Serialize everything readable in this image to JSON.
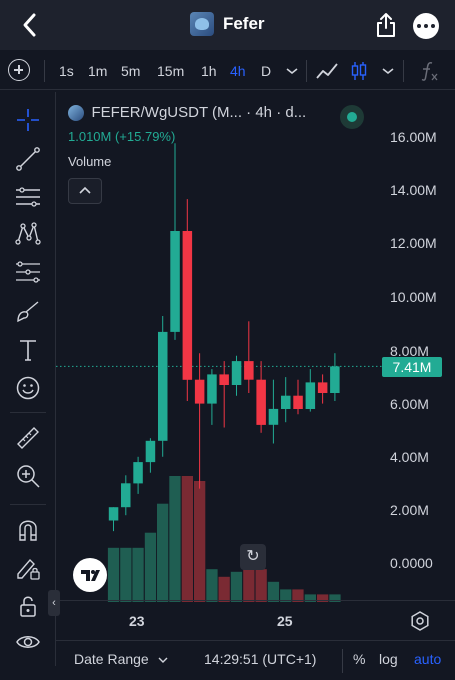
{
  "header": {
    "title": "Fefer",
    "back_icon": "chevron-left-icon",
    "share_icon": "share-icon",
    "more_icon": "more-horizontal-icon"
  },
  "toolbar": {
    "timeframes": [
      "1s",
      "1m",
      "5m",
      "15m",
      "1h",
      "4h",
      "D"
    ],
    "active_timeframe": "4h",
    "icons": [
      "add-indicator-icon",
      "chevron-down-icon",
      "line-tool-icon",
      "candles-icon",
      "chevron-down-icon",
      "formula-icon"
    ]
  },
  "left_tools": [
    "crosshair-icon",
    "trend-line-icon",
    "fib-icon",
    "pattern-icon",
    "projection-icon",
    "brush-icon",
    "text-icon",
    "emoji-icon",
    "ruler-icon",
    "zoom-in-icon",
    "magnet-icon",
    "pencil-lock-icon",
    "lock-icon",
    "eye-icon"
  ],
  "legend": {
    "symbol": "FEFER/WgUSDT (M... · 4h · d...",
    "change": "1.010M (+15.79%)",
    "volume_label": "Volume"
  },
  "price_axis": {
    "ticks": [
      "16.00M",
      "14.00M",
      "12.00M",
      "10.00M",
      "8.00M",
      "6.00M",
      "4.00M",
      "2.00M",
      "0.0000"
    ],
    "current_price": "7.41M"
  },
  "time_axis": {
    "ticks": [
      "23",
      "25"
    ]
  },
  "bottom_bar": {
    "date_range": "Date Range",
    "time": "14:29:51 (UTC+1)",
    "percent": "%",
    "log": "log",
    "auto": "auto"
  },
  "colors": {
    "up": "#22ab94",
    "down": "#f23645",
    "accent": "#2962ff",
    "background": "#131722"
  },
  "chart_data": {
    "type": "candlestick",
    "y_unit": "M",
    "ylim": [
      0,
      16
    ],
    "candles": [
      {
        "o": 1.6,
        "h": 2.1,
        "l": 1.2,
        "c": 2.1
      },
      {
        "o": 2.1,
        "h": 3.3,
        "l": 1.8,
        "c": 3.0
      },
      {
        "o": 3.0,
        "h": 4.0,
        "l": 2.6,
        "c": 3.8
      },
      {
        "o": 3.8,
        "h": 4.7,
        "l": 3.4,
        "c": 4.6
      },
      {
        "o": 4.6,
        "h": 9.3,
        "l": 4.0,
        "c": 8.7
      },
      {
        "o": 8.7,
        "h": 15.8,
        "l": 8.4,
        "c": 12.5
      },
      {
        "o": 12.5,
        "h": 13.7,
        "l": 6.1,
        "c": 6.9
      },
      {
        "o": 6.9,
        "h": 7.9,
        "l": 2.8,
        "c": 6.0
      },
      {
        "o": 6.0,
        "h": 7.3,
        "l": 5.2,
        "c": 7.1
      },
      {
        "o": 7.1,
        "h": 7.6,
        "l": 5.1,
        "c": 6.7
      },
      {
        "o": 6.7,
        "h": 7.8,
        "l": 6.3,
        "c": 7.6
      },
      {
        "o": 7.6,
        "h": 9.1,
        "l": 6.4,
        "c": 6.9
      },
      {
        "o": 6.9,
        "h": 7.6,
        "l": 4.9,
        "c": 5.2
      },
      {
        "o": 5.2,
        "h": 6.9,
        "l": 4.5,
        "c": 5.8
      },
      {
        "o": 5.8,
        "h": 7.0,
        "l": 5.3,
        "c": 6.3
      },
      {
        "o": 6.3,
        "h": 6.9,
        "l": 5.6,
        "c": 5.8
      },
      {
        "o": 5.8,
        "h": 7.3,
        "l": 5.7,
        "c": 6.8
      },
      {
        "o": 6.8,
        "h": 7.1,
        "l": 6.0,
        "c": 6.4
      },
      {
        "o": 6.4,
        "h": 7.9,
        "l": 6.1,
        "c": 7.4
      }
    ],
    "volume_relative": [
      0.43,
      0.43,
      0.43,
      0.55,
      0.78,
      1.0,
      1.0,
      0.96,
      0.26,
      0.2,
      0.24,
      0.3,
      0.26,
      0.16,
      0.1,
      0.1,
      0.06,
      0.06,
      0.06
    ]
  }
}
